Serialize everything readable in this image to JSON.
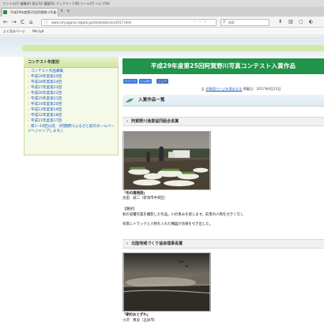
{
  "browser": {
    "menubar": "ファイル(F)  編集(E)  表示(V)  履歴(S)  ブックマーク(B)  ツール(T)  ヘルプ(H)",
    "tab_title": "平成29年度第25回阿賀野川写真コ",
    "tab_close": "×",
    "new_tab": "+",
    "back": "←",
    "forward": "→",
    "reload": "C",
    "home": "⌂",
    "url": "www.city.agano.niigata.jp/site/photocon/2017.html",
    "url_icons": "··· ♡ ☆",
    "search_placeholder": "検索",
    "toolbar_icons": [
      "⬇",
      "▥",
      "▢",
      "◐"
    ],
    "bookmarks": [
      "よく見るページ",
      "Me:Lyd"
    ]
  },
  "sidebar": {
    "title": "コンテスト年度別",
    "items": [
      "コンテスト作品募集",
      "平成29年度第25回",
      "平成28年度第24回",
      "平成27年度第23回",
      "平成26年度第22回",
      "平成25年度第21回",
      "平成24年度第20回",
      "平成23年度第19回",
      "平成22年度第18回",
      "平成21年度第17回",
      "第1~16回以前　(阿賀野川ふるさと館のホームページへジャンプします。)"
    ]
  },
  "main": {
    "title": "平成29年度第25回阿賀野川写真コンテスト入賞作品",
    "share": [
      "ツイート",
      "いいね!",
      "シェア"
    ],
    "print_link": "印刷用ページを表示する",
    "updated": "掲載日：2017年9月13日",
    "section_title": "入賞作品一覧",
    "awards": [
      {
        "heading": "阿賀野川漁業協同組合長賞",
        "photo_title": "「冬の風物詩」",
        "author": "太田　誠二（新潟市中央区）",
        "comment_label": "【講評】",
        "comment1": "秋の収穫作業を撮影した作品。川の恵みを感じます。前景の人物を大きく写し",
        "comment2": "背景にトラックと人物を入れた構図が効果を引き出した。"
      },
      {
        "heading": "北陸地域づくり協会理事長賞",
        "photo_title": "「朝のおとずれ」",
        "author": "小沢　勇良（五泉市）"
      }
    ]
  }
}
